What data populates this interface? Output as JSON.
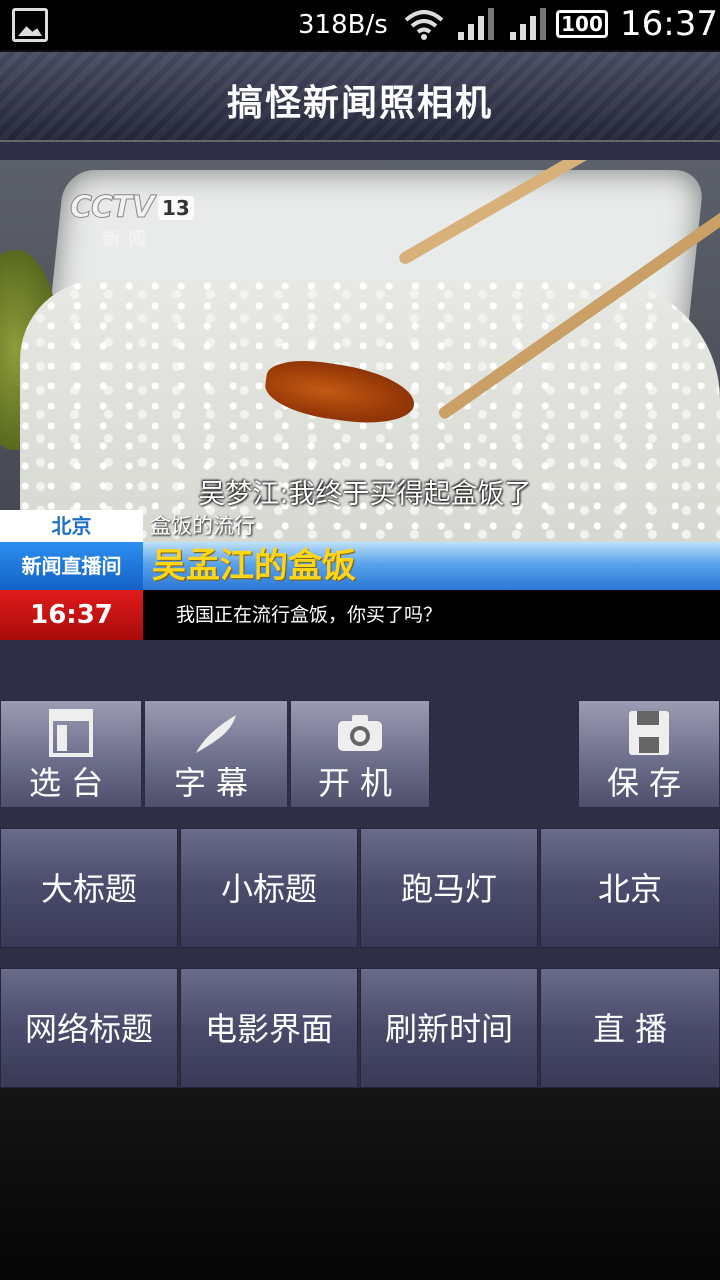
{
  "status_bar": {
    "speed": "318B/s",
    "battery": "100",
    "time": "16:37"
  },
  "title": "搞怪新闻照相机",
  "preview": {
    "channel_logo": "CCTV",
    "channel_number": "13",
    "channel_sub": "新闻",
    "quote": "吴梦江:我终于买得起盒饭了",
    "location": "北京",
    "small_title": "盒饭的流行",
    "studio": "新闻直播间",
    "headline": "吴孟江的盒饭",
    "clock": "16:37",
    "ticker": "我国正在流行盒饭，你买了吗？"
  },
  "toolbar": [
    {
      "label": "选台",
      "icon": "layout-icon"
    },
    {
      "label": "字幕",
      "icon": "quill-icon"
    },
    {
      "label": "开机",
      "icon": "camera-icon"
    },
    {
      "label": "保存",
      "icon": "floppy-icon"
    }
  ],
  "buttons_row1": [
    "大标题",
    "小标题",
    "跑马灯",
    "北京"
  ],
  "buttons_row2": [
    "网络标题",
    "电影界面",
    "刷新时间",
    "直 播"
  ]
}
